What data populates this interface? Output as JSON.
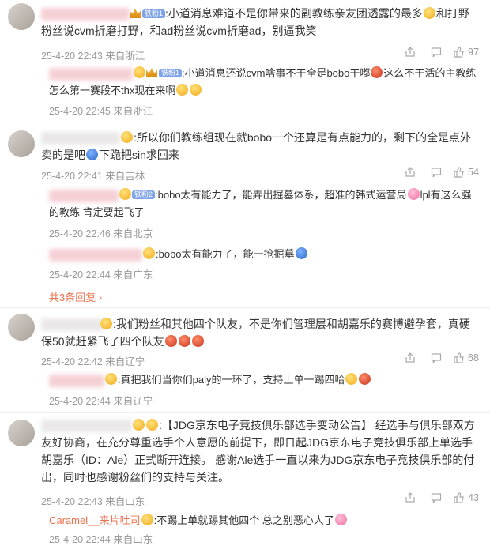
{
  "comments": [
    {
      "reply_text": ":小道消息难道不是你带来的副教练亲友团透露的最多",
      "reply_text2": "和打野粉丝说cvm折磨打野，和ad粉丝说cvm折磨ad，别逼我笑",
      "reply_meta": "25-4-20 22:43 来自浙江",
      "reply_likes": "97",
      "sub_badge": "铁粉1",
      "sub_text": ":小道消息还说cvm啥事不干全是bobo干嘟",
      "sub_text2": "这么不干活的主教练怎么第一赛段不thx现在来啊",
      "sub_meta": "25-4-20 22:45 来自浙江"
    },
    {
      "text": ":所以你们教练组现在就bobo一个还算是有点能力的，剩下的全是点外卖的是吧",
      "text2": "下跪把sin求回来",
      "meta": "25-4-20 22:41 来自吉林",
      "likes": "54",
      "sub1_badge": "铁粉2",
      "sub1_text": ":bobo太有能力了，能弄出掘墓体系，超准的韩式运营局",
      "sub1_text2": "lpl有这么强的教练 肯定要起飞了",
      "sub1_meta": "25-4-20 22:46 来自北京",
      "sub2_text": ":bobo太有能力了，能一抢掘墓",
      "sub2_meta": "25-4-20 22:44 来自广东",
      "more": "共3条回复"
    },
    {
      "text": ":我们粉丝和其他四个队友，不是你们管理层和胡嘉乐的赛博避孕套，真硬保50就赶紧飞了四个队友",
      "meta": "25-4-20 22:42 来自辽宁",
      "likes": "68",
      "sub_text": ":真把我们当你们paly的一环了，支持上单一踢四哈",
      "sub_meta": "25-4-20 22:44 来自辽宁"
    },
    {
      "text": ":【JDG京东电子竞技俱乐部选手变动公告】  经选手与俱乐部双方友好协商，在充分尊重选手个人意愿的前提下，即日起JDG京东电子竞技俱乐部上单选手胡嘉乐（ID：Ale）正式断开连接。  感谢Ale选手一直以来为JDG京东电子竞技俱乐部的付出，同时也感谢粉丝们的支持与关注。",
      "meta": "25-4-20 22:43 来自山东",
      "likes": "43",
      "sub_name": "Caramel__来片吐司",
      "sub_text": ":不踢上单就踢其他四个 总之别恶心人了",
      "sub_meta": "25-4-20 22:44 来自山东"
    }
  ]
}
